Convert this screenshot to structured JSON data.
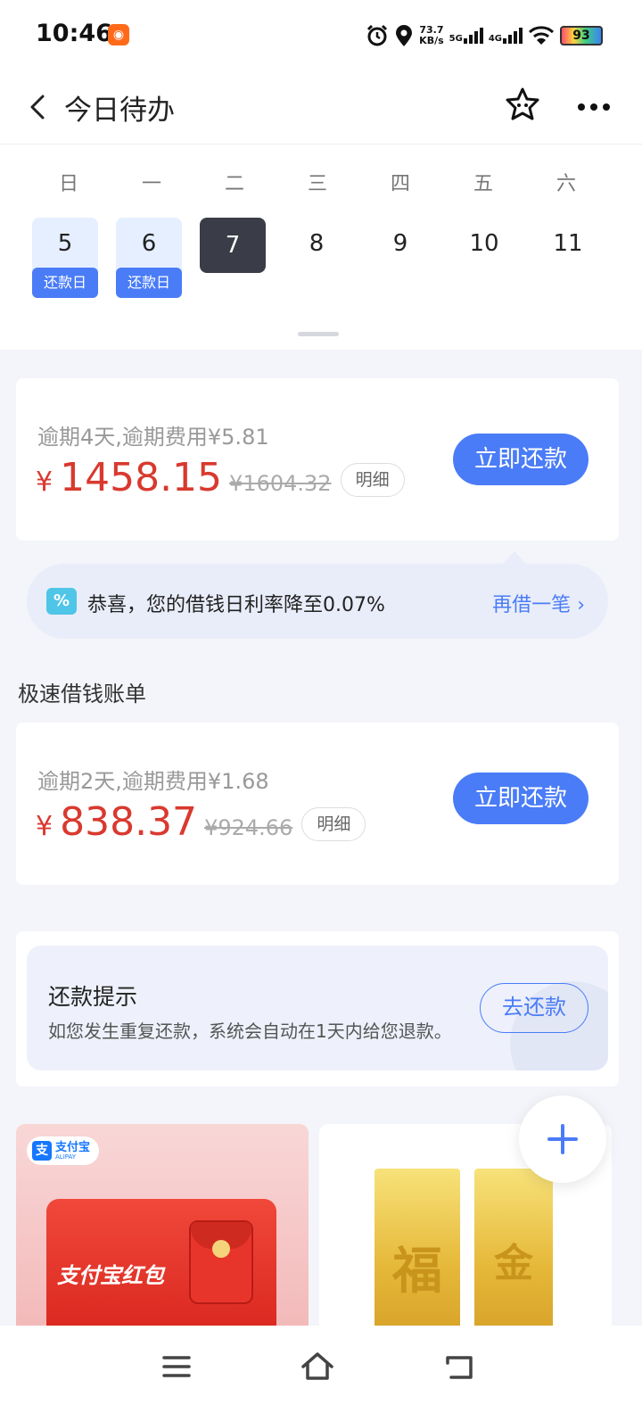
{
  "status": {
    "time": "10:46",
    "app_badge_icon": "kuaishou-icon",
    "net_speed_value": "73.7",
    "net_speed_unit": "KB/s",
    "sig1_label": "5G",
    "sig2_label": "4G",
    "battery": "93"
  },
  "nav": {
    "title": "今日待办"
  },
  "calendar": {
    "weekdays": [
      "日",
      "一",
      "二",
      "三",
      "四",
      "五",
      "六"
    ],
    "days": [
      "5",
      "6",
      "7",
      "8",
      "9",
      "10",
      "11"
    ],
    "due_label": "还款日"
  },
  "bill1": {
    "overdue": "逾期4天,逾期费用¥5.81",
    "currency": "¥",
    "amount": "1458.15",
    "original": "¥1604.32",
    "detail": "明细",
    "repay": "立即还款"
  },
  "promo": {
    "icon_text": "%",
    "text": "恭喜，您的借钱日利率降至0.07%",
    "link": "再借一笔"
  },
  "section_title": "极速借钱账单",
  "bill2": {
    "overdue": "逾期2天,逾期费用¥1.68",
    "currency": "¥",
    "amount": "838.37",
    "original": "¥924.66",
    "detail": "明细",
    "repay": "立即还款"
  },
  "tip": {
    "title": "还款提示",
    "desc": "如您发生重复还款，系统会自动在1天内给您退款。",
    "button": "去还款"
  },
  "ad_left": {
    "brand_mark": "支",
    "brand_name": "支付宝",
    "brand_sub": "ALIPAY",
    "headline": "支付宝红包"
  },
  "ad_right": {
    "bar1_char": "福",
    "bar2_char": "金"
  },
  "colors": {
    "accent": "#4a7cf7",
    "amount_red": "#d9392f",
    "selected_day": "#3a3d47"
  }
}
